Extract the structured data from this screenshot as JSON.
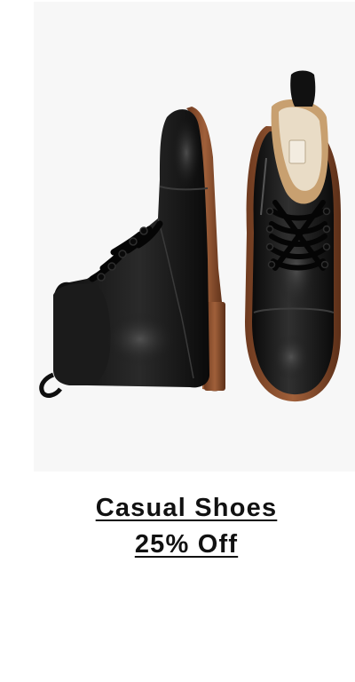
{
  "promo": {
    "title": "Casual Shoes",
    "discount": "25% Off"
  },
  "image": {
    "alt": "Black leather cap-toe lace-up boots"
  },
  "colors": {
    "background": "#ffffff",
    "image_background": "#f7f7f7",
    "text": "#111111",
    "leather": "#141414",
    "sole": "#8a4a2a",
    "lining": "#c8a070"
  }
}
